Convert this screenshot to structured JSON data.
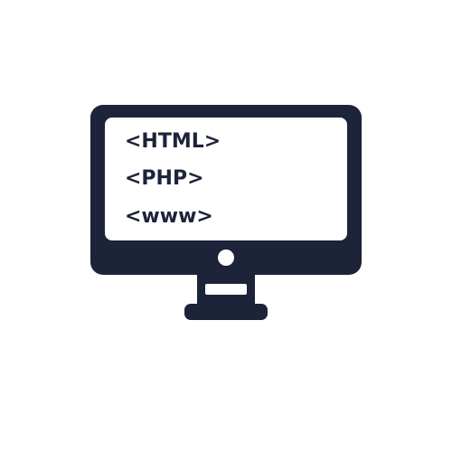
{
  "icon": {
    "name": "computer-monitor-code-icon",
    "color": "#1d2338",
    "screen_color": "#ffffff"
  },
  "screen": {
    "lines": [
      "<HTML>",
      "<PHP>",
      "<www>"
    ]
  }
}
